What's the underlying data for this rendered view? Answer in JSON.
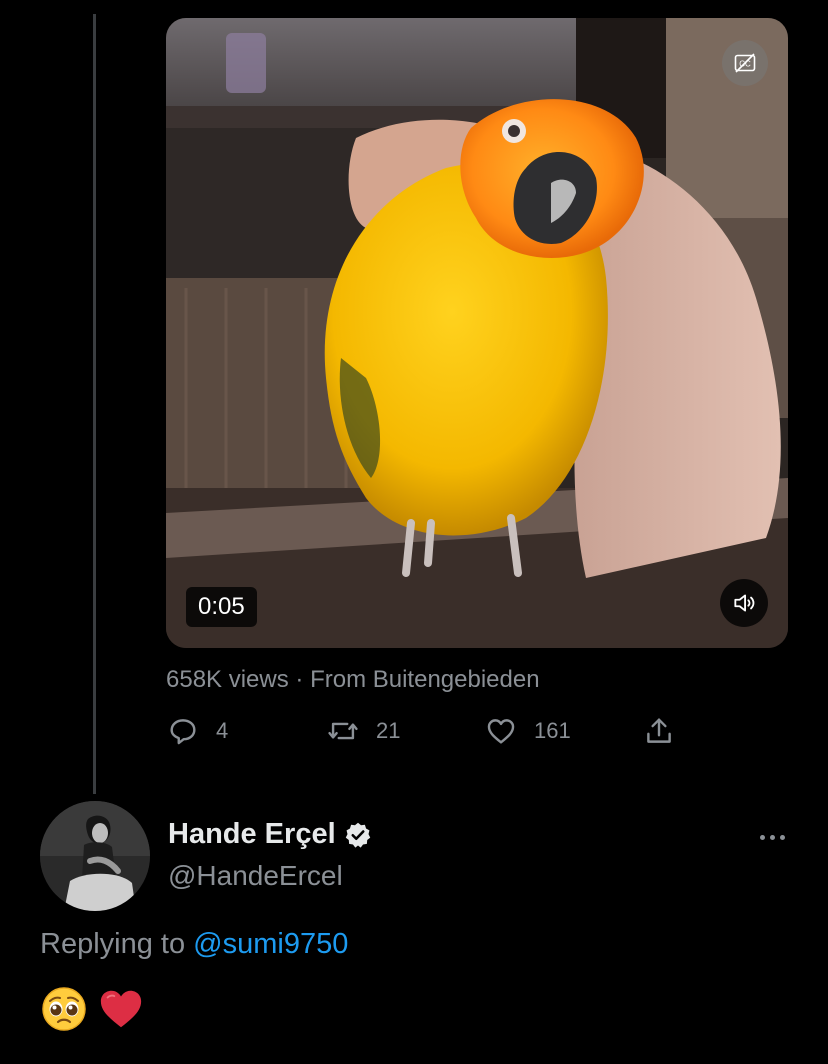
{
  "video": {
    "duration": "0:05",
    "captions_icon": "cc-off-icon",
    "volume_icon": "speaker-icon"
  },
  "tweet_meta": {
    "views": "658K views",
    "separator": "·",
    "source": "From Buitengebieden"
  },
  "actions": {
    "reply_count": "4",
    "retweet_count": "21",
    "like_count": "161"
  },
  "reply": {
    "name": "Hande Erçel",
    "handle": "@HandeErcel",
    "replying_prefix": "Replying to",
    "replying_to": "@sumi9750",
    "content_icons": [
      "pleading-face-emoji",
      "red-heart-emoji"
    ]
  },
  "colors": {
    "background": "#000000",
    "secondary_text": "#8b9096",
    "link": "#1d9bf0"
  }
}
